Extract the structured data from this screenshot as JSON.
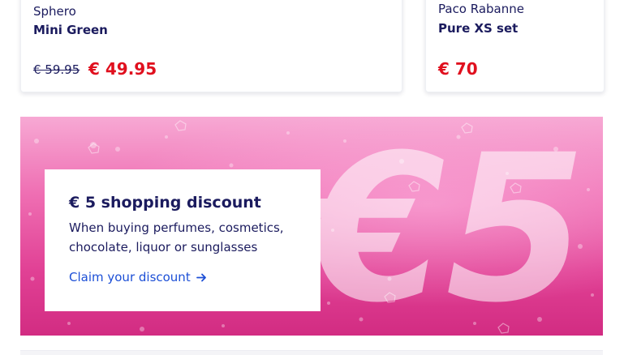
{
  "products": [
    {
      "brand": "Sphero",
      "name": "Mini Green",
      "old_price": "€ 59.95",
      "price": "€ 49.95"
    },
    {
      "brand": "Paco Rabanne",
      "name": "Pure XS set",
      "price": "€ 70"
    }
  ],
  "promo": {
    "title": "€ 5 shopping discount",
    "text": "When buying perfumes, cosmetics, chocolate, liquor or sunglasses",
    "link_label": "Claim your discount",
    "link_icon": "arrow-right-icon",
    "background_graphic_text": "€5"
  },
  "colors": {
    "text_primary": "#1b1b5e",
    "price_red": "#e0101e",
    "link_blue": "#1c4fd6",
    "banner_pink": "#e14195"
  }
}
